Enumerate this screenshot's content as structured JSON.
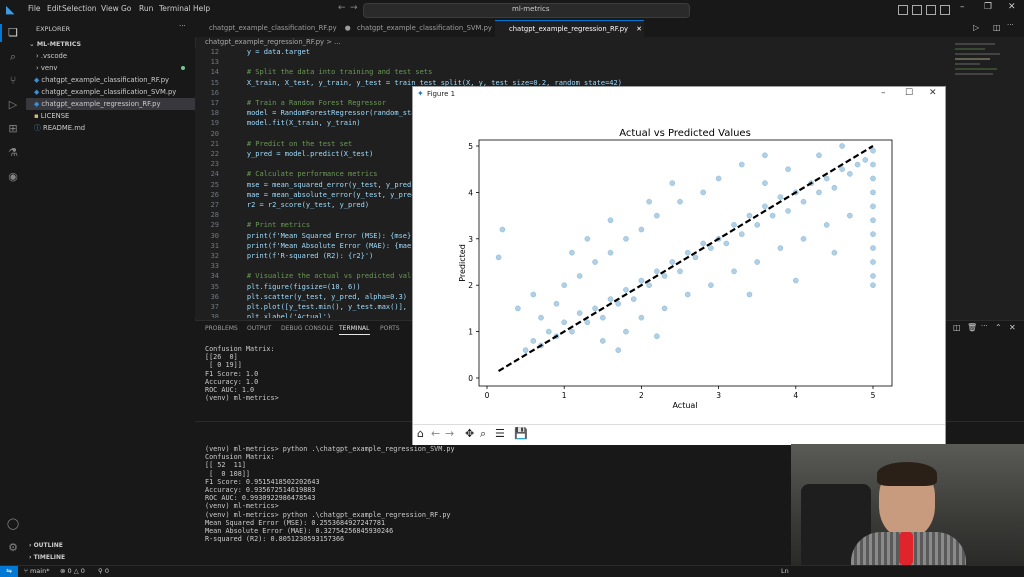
{
  "menu": [
    "File",
    "Edit",
    "Selection",
    "View",
    "Go",
    "Run",
    "Terminal",
    "Help"
  ],
  "search_text": "ml-metrics",
  "sidebar": {
    "header": "EXPLORER",
    "project": "ML-METRICS",
    "items": [
      ".vscode",
      "venv",
      "chatgpt_example_classification_RF.py",
      "chatgpt_example_classification_SVM.py",
      "chatgpt_example_regression_RF.py",
      "LICENSE",
      "README.md"
    ],
    "outline": "OUTLINE",
    "timeline": "TIMELINE"
  },
  "tabs": [
    "chatgpt_example_classification_RF.py",
    "chatgpt_example_classification_SVM.py",
    "chatgpt_example_regression_RF.py"
  ],
  "breadcrumb": "chatgpt_example_regression_RF.py > ...",
  "code_lines": [
    {
      "n": "12",
      "t": "    y = data.target"
    },
    {
      "n": "13",
      "t": ""
    },
    {
      "n": "14",
      "t": "    # Split the data into training and test sets"
    },
    {
      "n": "15",
      "t": "    X_train, X_test, y_train, y_test = train_test_split(X, y, test_size=0.2, random_state=42)"
    },
    {
      "n": "16",
      "t": ""
    },
    {
      "n": "17",
      "t": "    # Train a Random Forest Regressor"
    },
    {
      "n": "18",
      "t": "    model = RandomForestRegressor(random_state=42)"
    },
    {
      "n": "19",
      "t": "    model.fit(X_train, y_train)"
    },
    {
      "n": "20",
      "t": ""
    },
    {
      "n": "21",
      "t": "    # Predict on the test set"
    },
    {
      "n": "22",
      "t": "    y_pred = model.predict(X_test)"
    },
    {
      "n": "23",
      "t": ""
    },
    {
      "n": "24",
      "t": "    # Calculate performance metrics"
    },
    {
      "n": "25",
      "t": "    mse = mean_squared_error(y_test, y_pred)"
    },
    {
      "n": "26",
      "t": "    mae = mean_absolute_error(y_test, y_pred)"
    },
    {
      "n": "27",
      "t": "    r2 = r2_score(y_test, y_pred)"
    },
    {
      "n": "28",
      "t": ""
    },
    {
      "n": "29",
      "t": "    # Print metrics"
    },
    {
      "n": "30",
      "t": "    print(f'Mean Squared Error (MSE): {mse}')"
    },
    {
      "n": "31",
      "t": "    print(f'Mean Absolute Error (MAE): {mae}')"
    },
    {
      "n": "32",
      "t": "    print(f'R-squared (R2): {r2}')"
    },
    {
      "n": "33",
      "t": ""
    },
    {
      "n": "34",
      "t": "    # Visualize the actual vs predicted values"
    },
    {
      "n": "35",
      "t": "    plt.figure(figsize=(10, 6))"
    },
    {
      "n": "36",
      "t": "    plt.scatter(y_test, y_pred, alpha=0.3)"
    },
    {
      "n": "37",
      "t": "    plt.plot([y_test.min(), y_test.max()], [y_te"
    },
    {
      "n": "38",
      "t": "    plt.xlabel('Actual')"
    }
  ],
  "panel_tabs": [
    "PROBLEMS",
    "OUTPUT",
    "DEBUG CONSOLE",
    "TERMINAL",
    "PORTS"
  ],
  "terminal_top": [
    "Confusion Matrix:",
    "[[26  0]",
    " [ 0 19]]",
    "F1 Score: 1.0",
    "Accuracy: 1.0",
    "ROC AUC: 1.0",
    "(venv) ml-metrics>"
  ],
  "terminal_bottom": [
    "(venv) ml-metrics> python .\\chatgpt_example_regression_SVM.py",
    "Confusion Matrix:",
    "[[ 52  11]",
    " [  0 108]]",
    "F1 Score: 0.9515418502202643",
    "Accuracy: 0.935672514619883",
    "ROC AUC: 0.9930922986478543",
    "(venv) ml-metrics>",
    "(venv) ml-metrics> python .\\chatgpt_example_regression_RF.py",
    "Mean Squared Error (MSE): 0.2553684927247781",
    "Mean Absolute Error (MAE): 0.32754256845930246",
    "R-squared (R2): 0.8051230593157366"
  ],
  "status": {
    "branch": "main*",
    "problems": "0 △ 0",
    "ports": "0",
    "ln": "Ln"
  },
  "figure": {
    "title": "Figure 1"
  },
  "chart_data": {
    "type": "scatter",
    "title": "Actual vs Predicted Values",
    "xlabel": "Actual",
    "ylabel": "Predicted",
    "xlim": [
      0,
      5
    ],
    "ylim": [
      0,
      5
    ],
    "xticks": [
      "0",
      "1",
      "2",
      "3",
      "4",
      "5"
    ],
    "yticks": [
      "0",
      "1",
      "2",
      "3",
      "4",
      "5"
    ],
    "point_color": "#1f77b4",
    "line_color": "#000000",
    "diagonal": [
      [
        0.15,
        0.15
      ],
      [
        5.0,
        5.0
      ]
    ],
    "series": [
      {
        "values": [
          [
            0.5,
            0.6
          ],
          [
            0.6,
            0.8
          ],
          [
            0.7,
            0.7
          ],
          [
            0.8,
            1.0
          ],
          [
            0.9,
            0.9
          ],
          [
            1.0,
            1.2
          ],
          [
            1.1,
            1.0
          ],
          [
            1.2,
            1.4
          ],
          [
            1.3,
            1.2
          ],
          [
            1.4,
            1.5
          ],
          [
            1.5,
            1.3
          ],
          [
            1.6,
            1.7
          ],
          [
            1.7,
            1.6
          ],
          [
            1.8,
            1.9
          ],
          [
            1.9,
            1.7
          ],
          [
            2.0,
            2.1
          ],
          [
            2.1,
            2.0
          ],
          [
            2.2,
            2.3
          ],
          [
            2.3,
            2.2
          ],
          [
            2.4,
            2.5
          ],
          [
            2.5,
            2.3
          ],
          [
            2.6,
            2.7
          ],
          [
            2.7,
            2.6
          ],
          [
            2.8,
            2.9
          ],
          [
            2.9,
            2.8
          ],
          [
            3.0,
            3.0
          ],
          [
            3.1,
            2.9
          ],
          [
            3.2,
            3.3
          ],
          [
            3.3,
            3.1
          ],
          [
            3.4,
            3.5
          ],
          [
            3.5,
            3.3
          ],
          [
            3.6,
            3.7
          ],
          [
            3.7,
            3.5
          ],
          [
            3.8,
            3.9
          ],
          [
            3.9,
            3.6
          ],
          [
            4.0,
            4.0
          ],
          [
            4.1,
            3.8
          ],
          [
            4.2,
            4.2
          ],
          [
            4.3,
            4.0
          ],
          [
            4.4,
            4.3
          ],
          [
            4.5,
            4.1
          ],
          [
            4.6,
            4.5
          ],
          [
            4.7,
            4.4
          ],
          [
            4.8,
            4.6
          ],
          [
            4.9,
            4.7
          ],
          [
            5.0,
            4.9
          ],
          [
            5.0,
            4.6
          ],
          [
            5.0,
            4.3
          ],
          [
            5.0,
            4.0
          ],
          [
            5.0,
            3.7
          ],
          [
            5.0,
            3.4
          ],
          [
            5.0,
            3.1
          ],
          [
            5.0,
            2.8
          ],
          [
            5.0,
            2.5
          ],
          [
            5.0,
            2.2
          ],
          [
            5.0,
            2.0
          ],
          [
            0.7,
            1.3
          ],
          [
            0.9,
            1.6
          ],
          [
            1.0,
            2.0
          ],
          [
            1.2,
            2.2
          ],
          [
            1.4,
            2.5
          ],
          [
            1.6,
            2.7
          ],
          [
            1.8,
            3.0
          ],
          [
            2.0,
            3.2
          ],
          [
            2.2,
            3.5
          ],
          [
            2.5,
            3.8
          ],
          [
            2.8,
            4.0
          ],
          [
            3.0,
            4.3
          ],
          [
            3.3,
            4.6
          ],
          [
            3.6,
            4.8
          ],
          [
            1.5,
            0.8
          ],
          [
            1.8,
            1.0
          ],
          [
            2.0,
            1.3
          ],
          [
            2.3,
            1.5
          ],
          [
            2.6,
            1.8
          ],
          [
            2.9,
            2.0
          ],
          [
            3.2,
            2.3
          ],
          [
            3.5,
            2.5
          ],
          [
            3.8,
            2.8
          ],
          [
            4.1,
            3.0
          ],
          [
            4.4,
            3.3
          ],
          [
            4.7,
            3.5
          ],
          [
            0.2,
            3.2
          ],
          [
            0.15,
            2.6
          ],
          [
            0.4,
            1.5
          ],
          [
            0.6,
            1.8
          ],
          [
            1.1,
            2.7
          ],
          [
            1.3,
            3.0
          ],
          [
            1.6,
            3.4
          ],
          [
            2.4,
            4.2
          ],
          [
            2.1,
            3.8
          ],
          [
            3.4,
            1.8
          ],
          [
            4.0,
            2.1
          ],
          [
            4.5,
            2.7
          ],
          [
            3.9,
            4.5
          ],
          [
            4.3,
            4.8
          ],
          [
            4.6,
            5.0
          ],
          [
            3.6,
            4.2
          ],
          [
            1.7,
            0.6
          ],
          [
            2.2,
            0.9
          ]
        ]
      }
    ]
  }
}
